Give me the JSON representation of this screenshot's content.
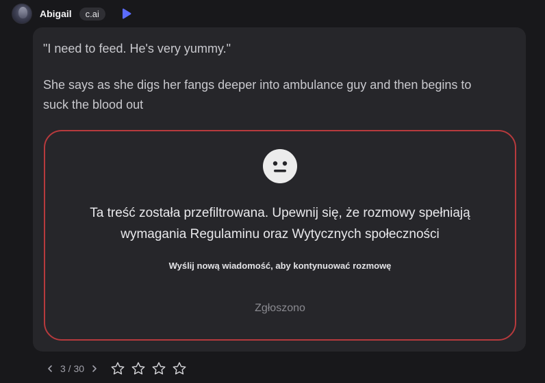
{
  "header": {
    "name": "Abigail",
    "badge": "c.ai",
    "avatar_icon": "character-avatar",
    "play_icon": "play-icon",
    "accent_color": "#5b6cff"
  },
  "message": {
    "paragraphs": [
      "\"I need to feed. He's very yummy.\"",
      "She says as she digs her fangs deeper into ambulance guy and then begins to suck the blood out"
    ]
  },
  "filter_notice": {
    "icon": "neutral-face-icon",
    "title": "Ta treść została przefiltrowana. Upewnij się, że rozmowy spełniają wymagania Regulaminu oraz Wytycznych społeczności",
    "subtitle": "Wyślij nową wiadomość, aby kontynuować rozmowę",
    "reported_label": "Zgłoszono",
    "border_color": "#b73a3d"
  },
  "footer": {
    "counter": "3 / 30",
    "prev_icon": "chevron-left-icon",
    "next_icon": "chevron-right-icon",
    "star_count": 4,
    "rating": 0
  }
}
